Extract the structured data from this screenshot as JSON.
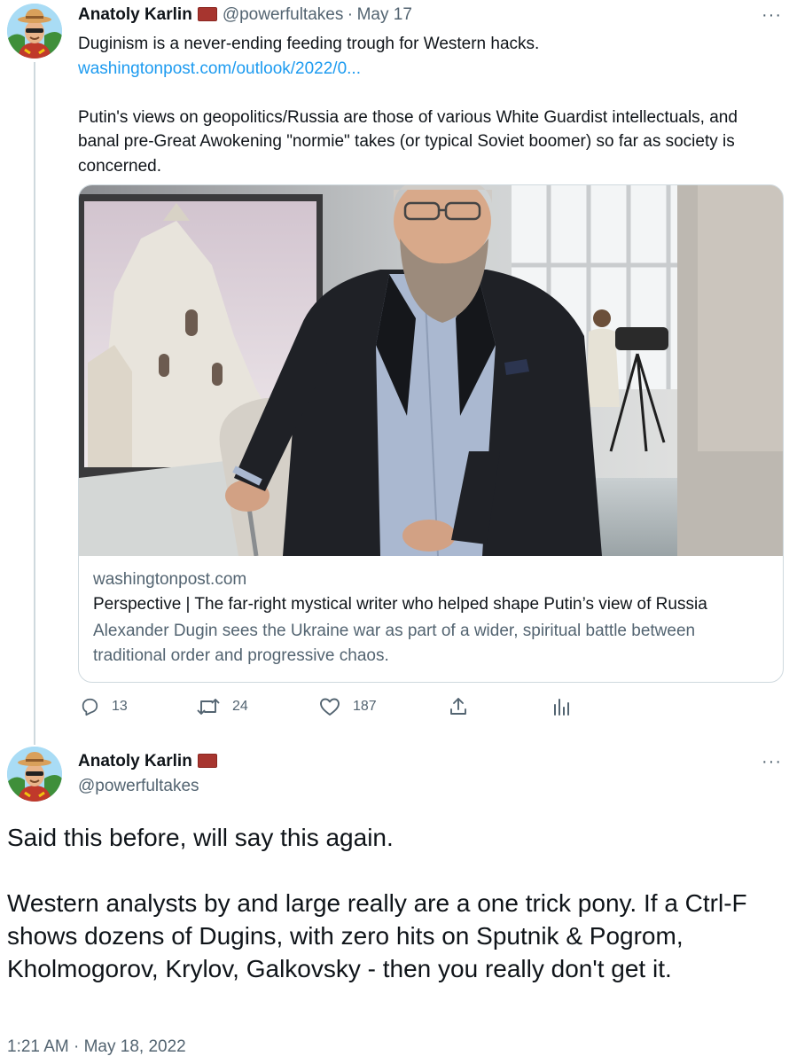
{
  "tweet1": {
    "author_name": "Anatoly Karlin",
    "handle": "@powerfultakes",
    "separator": "·",
    "date": "May 17",
    "more_label": "···",
    "text_line1": "Duginism is a never-ending feeding trough for Western hacks.",
    "link_text": "washingtonpost.com/outlook/2022/0...",
    "text_paragraph2": "Putin's views on geopolitics/Russia are those of various White Guardist intellectuals, and banal pre-Great Awokening \"normie\" takes (or typical Soviet boomer) so far as society is concerned.",
    "card": {
      "domain": "washingtonpost.com",
      "title": "Perspective | The far-right mystical writer who helped shape Putin’s view of Russia",
      "description": "Alexander Dugin sees the Ukraine war as part of a wider, spiritual battle between traditional order and progressive chaos."
    },
    "actions": {
      "replies": "13",
      "retweets": "24",
      "likes": "187"
    },
    "icons": [
      "reply-icon",
      "retweet-icon",
      "like-icon",
      "share-icon",
      "analytics-icon",
      "more-icon"
    ]
  },
  "tweet2": {
    "author_name": "Anatoly Karlin",
    "handle": "@powerfultakes",
    "more_label": "···",
    "paragraph1": "Said this before, will say this again.",
    "paragraph2": "Western analysts by and large really are a one trick pony. If a Ctrl-F shows dozens of Dugins, with zero hits on Sputnik & Pogrom, Kholmogorov, Krylov, Galkovsky - then you really don't get it.",
    "timestamp": "1:21 AM · May 18, 2022"
  },
  "colors": {
    "link": "#1d9bf0",
    "muted": "#536471",
    "text": "#0f1419",
    "border": "#cfd9de",
    "flag": "#a7352f"
  }
}
